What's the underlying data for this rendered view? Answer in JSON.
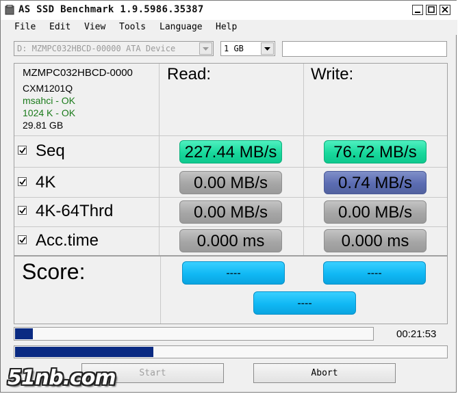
{
  "window": {
    "title": "AS SSD Benchmark 1.9.5986.35387"
  },
  "menu": [
    "File",
    "Edit",
    "View",
    "Tools",
    "Language",
    "Help"
  ],
  "toolbar": {
    "drive_select": "D: MZMPC032HBCD-00000 ATA Device",
    "size_select": "1 GB",
    "info_field": ""
  },
  "device": {
    "model": "MZMPC032HBCD-0000",
    "firmware": "CXM1201Q",
    "driver_status": "msahci - OK",
    "alignment_status": "1024 K - OK",
    "capacity": "29.81 GB"
  },
  "columns": {
    "read": "Read:",
    "write": "Write:"
  },
  "rows": [
    {
      "label": "Seq",
      "checked": true,
      "read": "227.44 MB/s",
      "write": "76.72 MB/s",
      "read_color": "green",
      "write_color": "green"
    },
    {
      "label": "4K",
      "checked": true,
      "read": "0.00 MB/s",
      "write": "0.74 MB/s",
      "read_color": "gray",
      "write_color": "blue"
    },
    {
      "label": "4K-64Thrd",
      "checked": true,
      "read": "0.00 MB/s",
      "write": "0.00 MB/s",
      "read_color": "gray",
      "write_color": "gray"
    },
    {
      "label": "Acc.time",
      "checked": true,
      "read": "0.000 ms",
      "write": "0.000 ms",
      "read_color": "gray",
      "write_color": "gray"
    }
  ],
  "score": {
    "label": "Score:",
    "read": "----",
    "write": "----",
    "total": "----"
  },
  "progress": {
    "current_fraction": 0.05,
    "total_fraction": 0.32,
    "elapsed": "00:21:53"
  },
  "buttons": {
    "start": "Start",
    "abort": "Abort"
  },
  "watermark": "51nb.com",
  "colors": {
    "green": "#18d89c",
    "gray": "#a6a6a6",
    "blue": "#5b6cb2",
    "score": "#10b8f4",
    "progress": "#0a2a82"
  }
}
